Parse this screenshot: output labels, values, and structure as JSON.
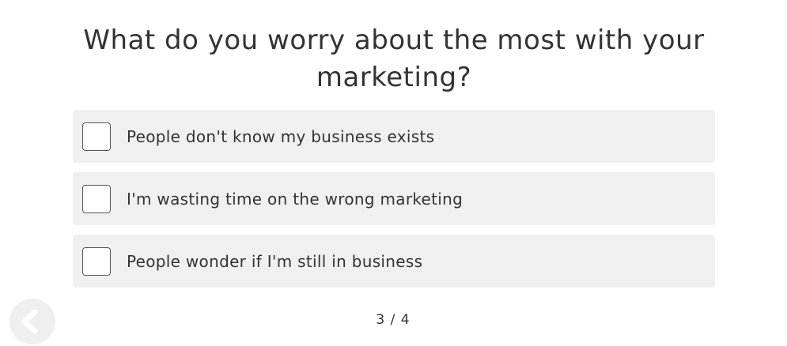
{
  "question": {
    "title": "What do you worry about the most with your marketing?"
  },
  "options": [
    {
      "label": "People don't know my business exists",
      "checked": false
    },
    {
      "label": "I'm wasting time on the wrong marketing",
      "checked": false
    },
    {
      "label": "People wonder if I'm still in business",
      "checked": false
    }
  ],
  "navigation": {
    "back_icon": "chevron-left-icon",
    "progress": "3 / 4"
  },
  "colors": {
    "option_background": "#f0f0f0",
    "text": "#333333",
    "back_button_background": "#efefef",
    "back_icon": "#ffffff"
  }
}
